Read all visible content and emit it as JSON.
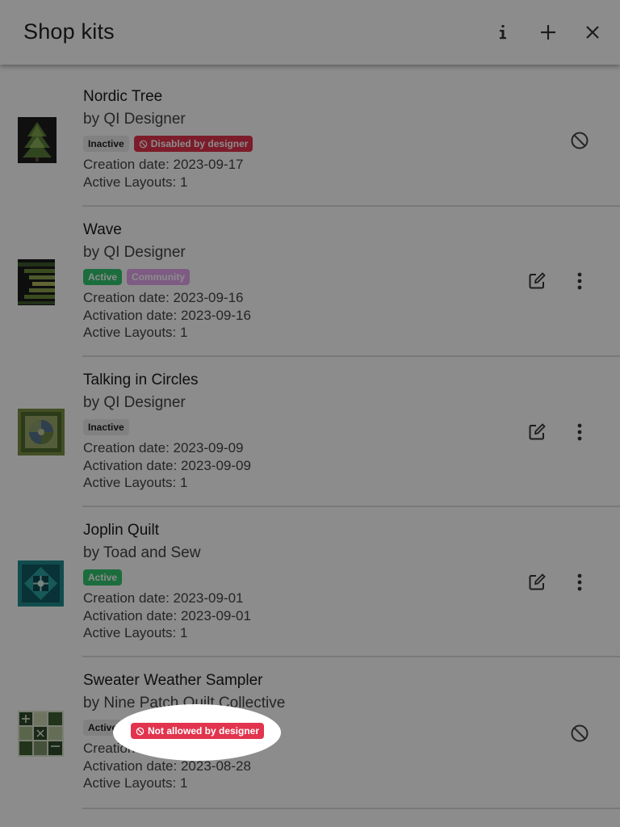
{
  "header": {
    "title": "Shop kits",
    "info_icon": "info-icon",
    "add_icon": "plus-icon",
    "close_icon": "close-icon"
  },
  "colors": {
    "active": "#34c770",
    "community": "#e3a6ee",
    "danger": "#e2344e",
    "inactive_bg": "#ececec",
    "dim_overlay": "rgba(0,0,0,0.45)"
  },
  "kits": [
    {
      "name": "Nordic Tree",
      "by": "by QI Designer",
      "badges": [
        {
          "label": "Inactive",
          "kind": "inactive"
        },
        {
          "label": "Disabled by designer",
          "kind": "danger",
          "icon": "block-icon"
        }
      ],
      "details": [
        "Creation date: 2023-09-17",
        "Active Layouts: 1"
      ],
      "actions": [
        "block-icon"
      ]
    },
    {
      "name": "Wave",
      "by": "by QI Designer",
      "badges": [
        {
          "label": "Active",
          "kind": "active"
        },
        {
          "label": "Community",
          "kind": "community"
        }
      ],
      "details": [
        "Creation date: 2023-09-16",
        "Activation date: 2023-09-16",
        "Active Layouts: 1"
      ],
      "actions": [
        "edit-icon",
        "more-vertical-icon"
      ]
    },
    {
      "name": "Talking in Circles",
      "by": "by QI Designer",
      "badges": [
        {
          "label": "Inactive",
          "kind": "inactive"
        }
      ],
      "details": [
        "Creation date: 2023-09-09",
        "Activation date: 2023-09-09",
        "Active Layouts: 1"
      ],
      "actions": [
        "edit-icon",
        "more-vertical-icon"
      ]
    },
    {
      "name": "Joplin Quilt",
      "by": "by Toad and Sew",
      "badges": [
        {
          "label": "Active",
          "kind": "active"
        }
      ],
      "details": [
        "Creation date: 2023-09-01",
        "Activation date: 2023-09-01",
        "Active Layouts: 1"
      ],
      "actions": [
        "edit-icon",
        "more-vertical-icon"
      ]
    },
    {
      "name": "Sweater Weather Sampler",
      "by": "by Nine Patch Quilt Collective",
      "badges": [
        {
          "label": "Active",
          "kind": "inactive"
        },
        {
          "label": "Not allowed by designer",
          "kind": "danger",
          "icon": "block-icon"
        }
      ],
      "details": [
        "Creation date: 2023-08-28",
        "Activation date: 2023-08-28",
        "Active Layouts: 1"
      ],
      "actions": [
        "block-icon"
      ]
    }
  ]
}
